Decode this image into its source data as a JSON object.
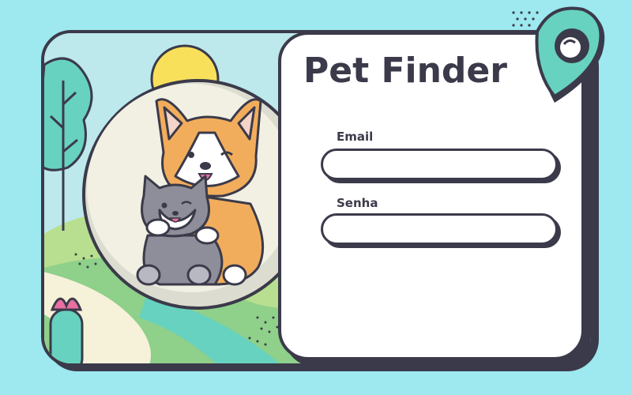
{
  "app": {
    "title": "Pet Finder"
  },
  "form": {
    "email_label": "Email",
    "email_value": "",
    "password_label": "Senha",
    "password_value": ""
  },
  "icons": {
    "pin": "location-pin-icon",
    "illustration": "corgi-and-cat-illustration"
  },
  "colors": {
    "background": "#9ee8ef",
    "outline": "#3b3a4a",
    "accent_teal": "#67d2bf",
    "sun": "#f9e05b",
    "corgi": "#f2ad5c",
    "cat": "#8d8e99"
  }
}
